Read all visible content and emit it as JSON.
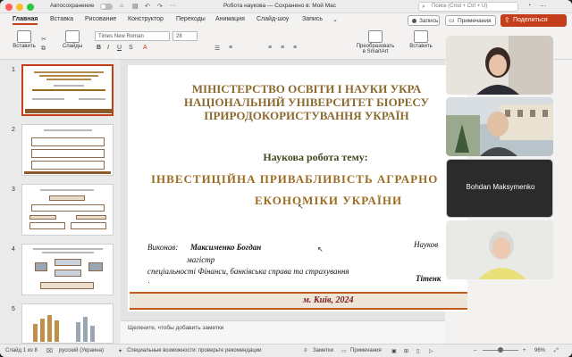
{
  "titlebar": {
    "autosave_label": "Автосохранение",
    "doc_title": "Робота наукова — Сохранено в: Мой Mac",
    "search_placeholder": "Поиск (Cmd + Ctrl + U)"
  },
  "tabs": [
    "Главная",
    "Вставка",
    "Рисование",
    "Конструктор",
    "Переходы",
    "Анимация",
    "Слайд-шоу",
    "Запись"
  ],
  "actions": {
    "record": "Запись",
    "notes": "Примечания",
    "share": "Поделиться"
  },
  "ribbon": {
    "paste": "Вставить",
    "slides": "Слайды",
    "font": "Times New Roman",
    "size": "28",
    "smartart": "Преобразовать в SmartArt",
    "insert2": "Вставить"
  },
  "thumbnails": [
    "1",
    "2",
    "3",
    "4",
    "5"
  ],
  "slide": {
    "ministry1": "МІНІСТЕРСТВО ОСВІТИ І НАУКИ УКРА",
    "ministry2": "НАЦІОНАЛЬНИЙ УНІВЕРСИТЕТ БІОРЕСУ",
    "ministry3": "ПРИРОДОКОРИСТУВАННЯ УКРАЇН",
    "subtitle": "Наукова робота тему:",
    "theme_line1": "ІНВЕСТИЦІЙНА ПРИВАБЛИВІСТЬ АГРАРНО",
    "theme_line2": "ЕКОНОМІКИ УКРАЇНИ",
    "performer_label": "Виконав:",
    "author": "Максименко Богдан",
    "degree": "магістр",
    "specialty": "спеціальності Фінанси, банківська справа та страхування",
    "dot": "·",
    "supervisor_label": "Науков",
    "supervisor": "Тітенк",
    "city": "м. Київ, 2024"
  },
  "notes_placeholder": "Щелкните, чтобы добавить заметки",
  "status": {
    "slide_of": "Слайд 1 из 8",
    "lang": "русский (Украина)",
    "accessibility": "Специальные возможности: проверьте рекомендации",
    "comments": "Заметки",
    "notes": "Примечания",
    "zoom": "96%"
  },
  "video": {
    "participant": "Bohdan Maksymenko"
  },
  "colors": {
    "accent": "#c43e1c",
    "heading": "#8b6a2f",
    "theme": "#9c6b22",
    "city": "#7b1c1c"
  }
}
